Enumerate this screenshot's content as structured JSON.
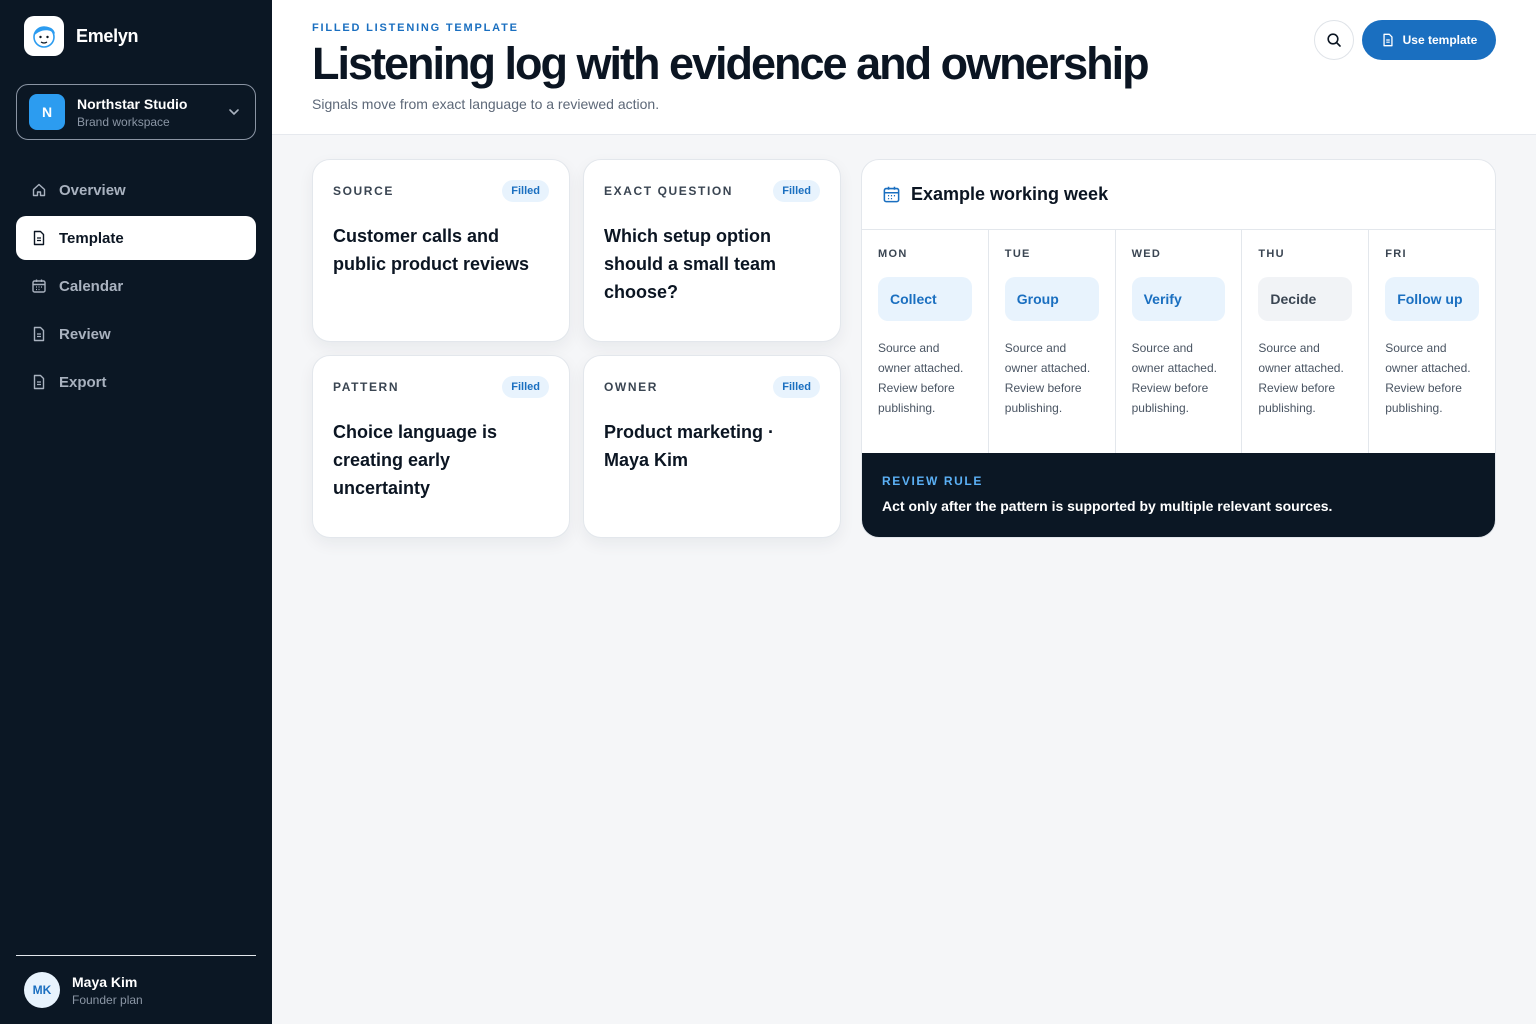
{
  "app": {
    "name": "Emelyn"
  },
  "workspace": {
    "name": "Northstar Studio",
    "subtitle": "Brand workspace",
    "initial": "N"
  },
  "nav": [
    {
      "label": "Overview",
      "icon": "home-icon",
      "active": false
    },
    {
      "label": "Template",
      "icon": "document-icon",
      "active": true
    },
    {
      "label": "Calendar",
      "icon": "calendar-icon",
      "active": false
    },
    {
      "label": "Review",
      "icon": "document-icon",
      "active": false
    },
    {
      "label": "Export",
      "icon": "document-icon",
      "active": false
    }
  ],
  "user": {
    "name": "Maya Kim",
    "plan": "Founder plan",
    "initials": "MK"
  },
  "header": {
    "eyebrow": "FILLED LISTENING TEMPLATE",
    "title": "Listening log with evidence and ownership",
    "subtitle": "Signals move from exact language to a reviewed action.",
    "use_template_label": "Use template"
  },
  "fields": [
    {
      "label": "SOURCE",
      "badge": "Filled",
      "value": "Customer calls and public product reviews"
    },
    {
      "label": "EXACT QUESTION",
      "badge": "Filled",
      "value": "Which setup option should a small team choose?"
    },
    {
      "label": "PATTERN",
      "badge": "Filled",
      "value": "Choice language is creating early uncertainty"
    },
    {
      "label": "OWNER",
      "badge": "Filled",
      "value": "Product marketing · Maya Kim"
    }
  ],
  "week": {
    "title": "Example working week",
    "days": [
      {
        "day": "MON",
        "action": "Collect",
        "note": "Source and owner attached. Review before publishing.",
        "style": "accent"
      },
      {
        "day": "TUE",
        "action": "Group",
        "note": "Source and owner attached. Review before publishing.",
        "style": "accent"
      },
      {
        "day": "WED",
        "action": "Verify",
        "note": "Source and owner attached. Review before publishing.",
        "style": "accent"
      },
      {
        "day": "THU",
        "action": "Decide",
        "note": "Source and owner attached. Review before publishing.",
        "style": "neutral"
      },
      {
        "day": "FRI",
        "action": "Follow up",
        "note": "Source and owner attached. Review before publishing.",
        "style": "accent"
      }
    ],
    "rule_label": "REVIEW RULE",
    "rule_text": "Act only after the pattern is supported by multiple relevant sources."
  },
  "colors": {
    "sidebar": "#0b1724",
    "accent": "#1a6fc0",
    "accent_soft": "#e8f3fd",
    "workspace_avatar": "#2c9cf0"
  }
}
